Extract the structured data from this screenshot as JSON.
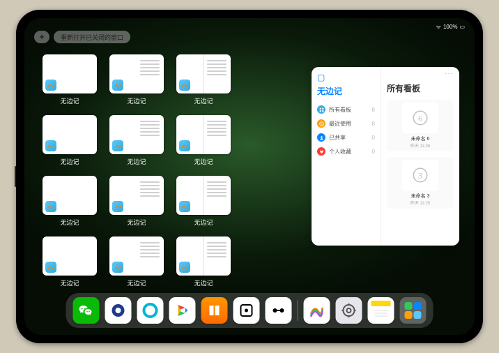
{
  "statusbar": {
    "signal": "•••",
    "wifi": "📶",
    "battery_pct": "100%"
  },
  "toppill": {
    "plus": "+",
    "reopen_label": "重新打开已关闭的窗口"
  },
  "app": {
    "name": "无边记"
  },
  "windows": [
    {
      "label": "无边记",
      "variant": "blank"
    },
    {
      "label": "无边记",
      "variant": "list"
    },
    {
      "label": "无边记",
      "variant": "split"
    },
    {
      "label": "无边记",
      "variant": "blank"
    },
    {
      "label": "无边记",
      "variant": "list"
    },
    {
      "label": "无边记",
      "variant": "split"
    },
    {
      "label": "无边记",
      "variant": "blank"
    },
    {
      "label": "无边记",
      "variant": "list"
    },
    {
      "label": "无边记",
      "variant": "split"
    },
    {
      "label": "无边记",
      "variant": "blank"
    },
    {
      "label": "无边记",
      "variant": "list"
    },
    {
      "label": "无边记",
      "variant": "split"
    }
  ],
  "panel": {
    "title": "无边记",
    "right_title": "所有看板",
    "more": "···",
    "categories": [
      {
        "label": "所有看板",
        "count": "8",
        "color": "#32ade6",
        "icon": "grid"
      },
      {
        "label": "最近使用",
        "count": "8",
        "color": "#ff9f0a",
        "icon": "clock"
      },
      {
        "label": "已共享",
        "count": "0",
        "color": "#0a84ff",
        "icon": "person"
      },
      {
        "label": "个人收藏",
        "count": "0",
        "color": "#ff3b30",
        "icon": "heart"
      }
    ],
    "boards": [
      {
        "name": "未命名 6",
        "date": "昨天 11:26",
        "glyph": "6"
      },
      {
        "name": "未命名 3",
        "date": "昨天 11:25",
        "glyph": "3"
      }
    ]
  },
  "dock": {
    "apps": [
      {
        "name": "wechat",
        "bg": "#09bb07",
        "glyph": "wechat"
      },
      {
        "name": "browser-hd",
        "bg": "#ffffff",
        "glyph": "circle-blue"
      },
      {
        "name": "quark",
        "bg": "#ffffff",
        "glyph": "circle-cyan"
      },
      {
        "name": "play",
        "bg": "#ffffff",
        "glyph": "play"
      },
      {
        "name": "books",
        "bg": "linear-gradient(#ff9500,#ff6b00)",
        "glyph": "books"
      },
      {
        "name": "dice",
        "bg": "#ffffff",
        "glyph": "dice"
      },
      {
        "name": "connect",
        "bg": "#ffffff",
        "glyph": "dots"
      },
      {
        "name": "freeform",
        "bg": "#ffffff",
        "glyph": "freeform"
      },
      {
        "name": "settings",
        "bg": "#e5e5ea",
        "glyph": "gear"
      },
      {
        "name": "notes",
        "bg": "#ffffff",
        "glyph": "notes"
      },
      {
        "name": "app-library",
        "bg": "rgba(255,255,255,.25)",
        "glyph": "library"
      }
    ]
  }
}
